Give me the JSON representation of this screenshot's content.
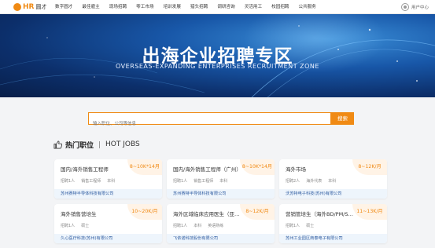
{
  "nav": {
    "logo_hr": "HR",
    "logo_name": "圆才",
    "items": [
      "数字圆才",
      "最佳雇主",
      "现场招聘",
      "零工市场",
      "培训发展",
      "猎头招聘",
      "调研咨询",
      "灵活用工",
      "校园招聘",
      "公共服务"
    ],
    "user_label": "用户中心"
  },
  "banner": {
    "title": "出海企业招聘专区",
    "subtitle": "OVERSEAS-EXPANDING ENTERPRISES RECRUITMENT ZONE"
  },
  "search": {
    "placeholder": "输入职位、公司等信息",
    "button": "搜索"
  },
  "hot": {
    "title_cn": "热门职位",
    "title_en": "HOT JOBS"
  },
  "jobs": [
    {
      "title": "国内/海外销售工程师",
      "salary": "8~10K*14月",
      "tags": [
        "招聘1人",
        "销售工程师",
        "本科"
      ],
      "company": "苏州赛特半导体科技有限公司"
    },
    {
      "title": "国内/海外销售工程师（广州）",
      "salary": "8~10K*14月",
      "tags": [
        "招聘1人",
        "销售工程师",
        "本科"
      ],
      "company": "苏州赛特半导体科技有限公司"
    },
    {
      "title": "海外市场",
      "salary": "8~12K/月",
      "tags": [
        "招聘2人",
        "海外代表",
        "本科"
      ],
      "company": "沃苏特电子科技(苏州)有限公司"
    },
    {
      "title": "海外销售营培生",
      "salary": "10~20K/月",
      "tags": [
        "招聘1人",
        "硕士"
      ],
      "company": "久心医疗科技(苏州)有限公司"
    },
    {
      "title": "海外区域临床应用医生（亚洲）",
      "salary": "8~12K/月",
      "tags": [
        "招聘1人",
        "本科",
        "英语熟练"
      ],
      "company": "飞依诺科技股份有限公司"
    },
    {
      "title": "营销管培生（海外BD/PM/Sales）",
      "salary": "11~13K/月",
      "tags": [
        "招聘1人",
        "硕士"
      ],
      "company": "苏州工业园区商泰电子有限公司"
    }
  ],
  "colors": {
    "accent": "#f08a14",
    "company_text": "#2c5aa0",
    "banner_dark": "#0c2f6b"
  }
}
